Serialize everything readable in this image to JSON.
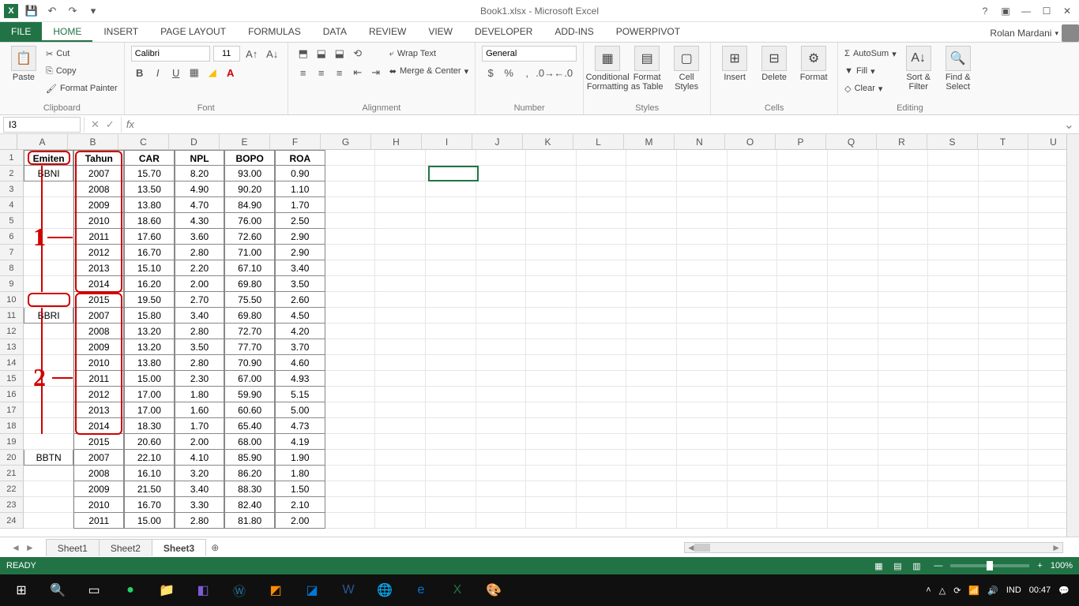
{
  "app": {
    "title": "Book1.xlsx - Microsoft Excel",
    "user": "Rolan Mardani"
  },
  "qat": {
    "save": "💾",
    "undo": "↶",
    "redo": "↷",
    "touch": "☝"
  },
  "tabs": [
    "FILE",
    "HOME",
    "INSERT",
    "PAGE LAYOUT",
    "FORMULAS",
    "DATA",
    "REVIEW",
    "VIEW",
    "DEVELOPER",
    "ADD-INS",
    "POWERPIVOT"
  ],
  "ribbon": {
    "clipboard": {
      "paste": "Paste",
      "cut": "Cut",
      "copy": "Copy",
      "fp": "Format Painter",
      "label": "Clipboard"
    },
    "font": {
      "name": "Calibri",
      "size": "11",
      "label": "Font"
    },
    "alignment": {
      "wrap": "Wrap Text",
      "merge": "Merge & Center",
      "label": "Alignment"
    },
    "number": {
      "fmt": "General",
      "label": "Number"
    },
    "styles": {
      "cond": "Conditional Formatting",
      "fat": "Format as Table",
      "cs": "Cell Styles",
      "label": "Styles"
    },
    "cells": {
      "ins": "Insert",
      "del": "Delete",
      "fmt": "Format",
      "label": "Cells"
    },
    "editing": {
      "sum": "AutoSum",
      "fill": "Fill",
      "clear": "Clear",
      "sort": "Sort & Filter",
      "find": "Find & Select",
      "label": "Editing"
    }
  },
  "namebox": "I3",
  "columns": [
    "A",
    "B",
    "C",
    "D",
    "E",
    "F",
    "G",
    "H",
    "I",
    "J",
    "K",
    "L",
    "M",
    "N",
    "O",
    "P",
    "Q",
    "R",
    "S",
    "T",
    "U"
  ],
  "activeCell": {
    "col": 8,
    "row": 3
  },
  "headerRow": [
    "Emiten",
    "Tahun",
    "CAR",
    "NPL",
    "BOPO",
    "ROA"
  ],
  "data": [
    [
      "BBNI",
      "2007",
      "15.70",
      "8.20",
      "93.00",
      "0.90"
    ],
    [
      "",
      "2008",
      "13.50",
      "4.90",
      "90.20",
      "1.10"
    ],
    [
      "",
      "2009",
      "13.80",
      "4.70",
      "84.90",
      "1.70"
    ],
    [
      "",
      "2010",
      "18.60",
      "4.30",
      "76.00",
      "2.50"
    ],
    [
      "",
      "2011",
      "17.60",
      "3.60",
      "72.60",
      "2.90"
    ],
    [
      "",
      "2012",
      "16.70",
      "2.80",
      "71.00",
      "2.90"
    ],
    [
      "",
      "2013",
      "15.10",
      "2.20",
      "67.10",
      "3.40"
    ],
    [
      "",
      "2014",
      "16.20",
      "2.00",
      "69.80",
      "3.50"
    ],
    [
      "",
      "2015",
      "19.50",
      "2.70",
      "75.50",
      "2.60"
    ],
    [
      "BBRI",
      "2007",
      "15.80",
      "3.40",
      "69.80",
      "4.50"
    ],
    [
      "",
      "2008",
      "13.20",
      "2.80",
      "72.70",
      "4.20"
    ],
    [
      "",
      "2009",
      "13.20",
      "3.50",
      "77.70",
      "3.70"
    ],
    [
      "",
      "2010",
      "13.80",
      "2.80",
      "70.90",
      "4.60"
    ],
    [
      "",
      "2011",
      "15.00",
      "2.30",
      "67.00",
      "4.93"
    ],
    [
      "",
      "2012",
      "17.00",
      "1.80",
      "59.90",
      "5.15"
    ],
    [
      "",
      "2013",
      "17.00",
      "1.60",
      "60.60",
      "5.00"
    ],
    [
      "",
      "2014",
      "18.30",
      "1.70",
      "65.40",
      "4.73"
    ],
    [
      "",
      "2015",
      "20.60",
      "2.00",
      "68.00",
      "4.19"
    ],
    [
      "BBTN",
      "2007",
      "22.10",
      "4.10",
      "85.90",
      "1.90"
    ],
    [
      "",
      "2008",
      "16.10",
      "3.20",
      "86.20",
      "1.80"
    ],
    [
      "",
      "2009",
      "21.50",
      "3.40",
      "88.30",
      "1.50"
    ],
    [
      "",
      "2010",
      "16.70",
      "3.30",
      "82.40",
      "2.10"
    ],
    [
      "",
      "2011",
      "15.00",
      "2.80",
      "81.80",
      "2.00"
    ]
  ],
  "annotations": {
    "num1": "1",
    "num2": "2"
  },
  "sheets": [
    "Sheet1",
    "Sheet2",
    "Sheet3"
  ],
  "activeSheet": 2,
  "status": {
    "ready": "READY",
    "zoom": "100%"
  },
  "taskbar": {
    "lang": "IND",
    "time": "00:47"
  }
}
